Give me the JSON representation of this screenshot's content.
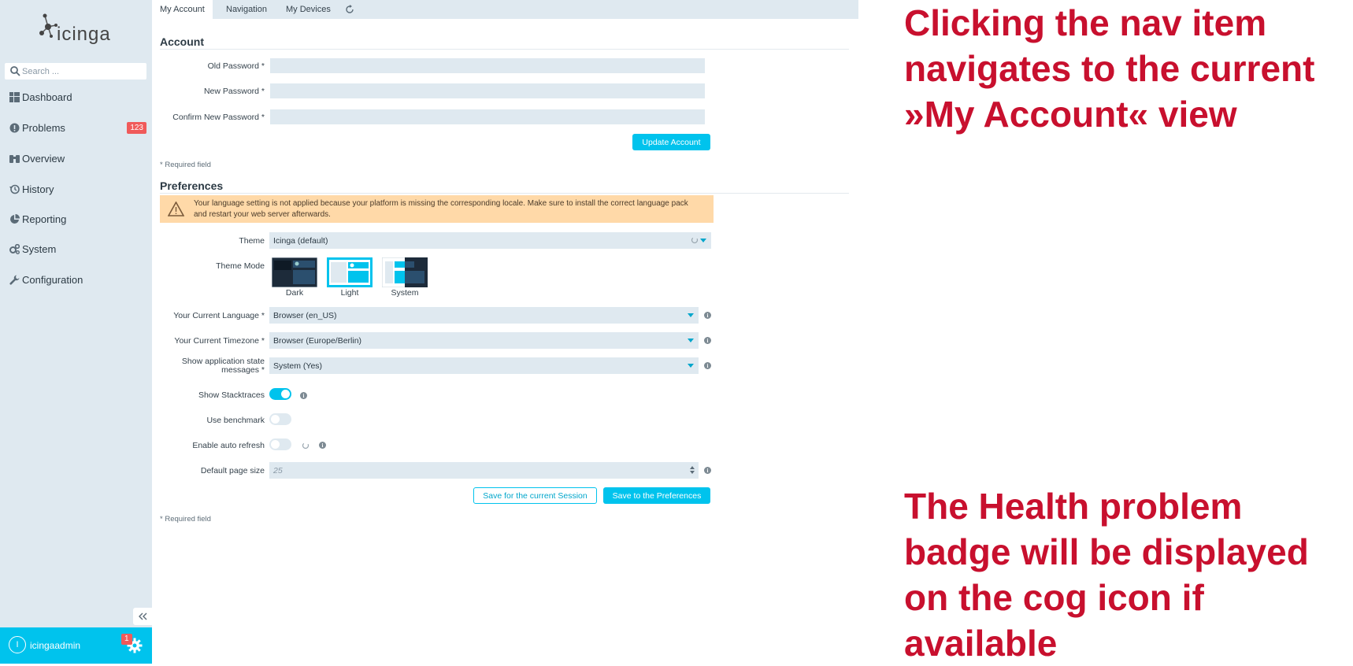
{
  "sidebar": {
    "logo_text": "icinga",
    "search_placeholder": "Search ...",
    "items": [
      {
        "label": "Dashboard",
        "icon": "dashboard-icon"
      },
      {
        "label": "Problems",
        "icon": "problems-icon",
        "badge": "123"
      },
      {
        "label": "Overview",
        "icon": "overview-icon"
      },
      {
        "label": "History",
        "icon": "history-icon"
      },
      {
        "label": "Reporting",
        "icon": "reporting-icon"
      },
      {
        "label": "System",
        "icon": "system-icon"
      },
      {
        "label": "Configuration",
        "icon": "wrench-icon"
      }
    ],
    "user": {
      "initial": "I",
      "name": "icingaadmin",
      "cog_badge": "1"
    }
  },
  "tabs": [
    "My Account",
    "Navigation",
    "My Devices"
  ],
  "account": {
    "title": "Account",
    "fields": [
      {
        "label": "Old Password *",
        "value": ""
      },
      {
        "label": "New Password *",
        "value": ""
      },
      {
        "label": "Confirm New Password *",
        "value": ""
      }
    ],
    "update_button": "Update Account",
    "required_note": "* Required field"
  },
  "preferences": {
    "title": "Preferences",
    "warning": "Your language setting is not applied because your platform is missing the corresponding locale. Make sure to install the correct language pack and restart your web server afterwards.",
    "theme_label": "Theme",
    "theme_value": "Icinga (default)",
    "theme_mode_label": "Theme Mode",
    "theme_modes": [
      "Dark",
      "Light",
      "System"
    ],
    "theme_mode_selected": "Light",
    "language_label": "Your Current Language *",
    "language_value": "Browser (en_US)",
    "timezone_label": "Your Current Timezone *",
    "timezone_value": "Browser (Europe/Berlin)",
    "app_state_label_1": "Show application state",
    "app_state_label_2": "messages *",
    "app_state_value": "System (Yes)",
    "stacktraces_label": "Show Stacktraces",
    "stacktraces_on": true,
    "benchmark_label": "Use benchmark",
    "benchmark_on": false,
    "auto_refresh_label": "Enable auto refresh",
    "auto_refresh_on": false,
    "page_size_label": "Default page size",
    "page_size_placeholder": "25",
    "save_session_button": "Save for the current Session",
    "save_prefs_button": "Save to the Preferences",
    "required_note": "* Required field"
  },
  "annotations": {
    "top": "Clicking the nav item navigates to the current »My Account« view",
    "bottom": "The Health problem badge will be displayed on the cog icon if available"
  },
  "colors": {
    "accent": "#00c3ed",
    "sidebar": "#dfe9f0",
    "badge": "#f05a5a",
    "warning": "#ffd9a8",
    "annotation": "#c8102e"
  }
}
